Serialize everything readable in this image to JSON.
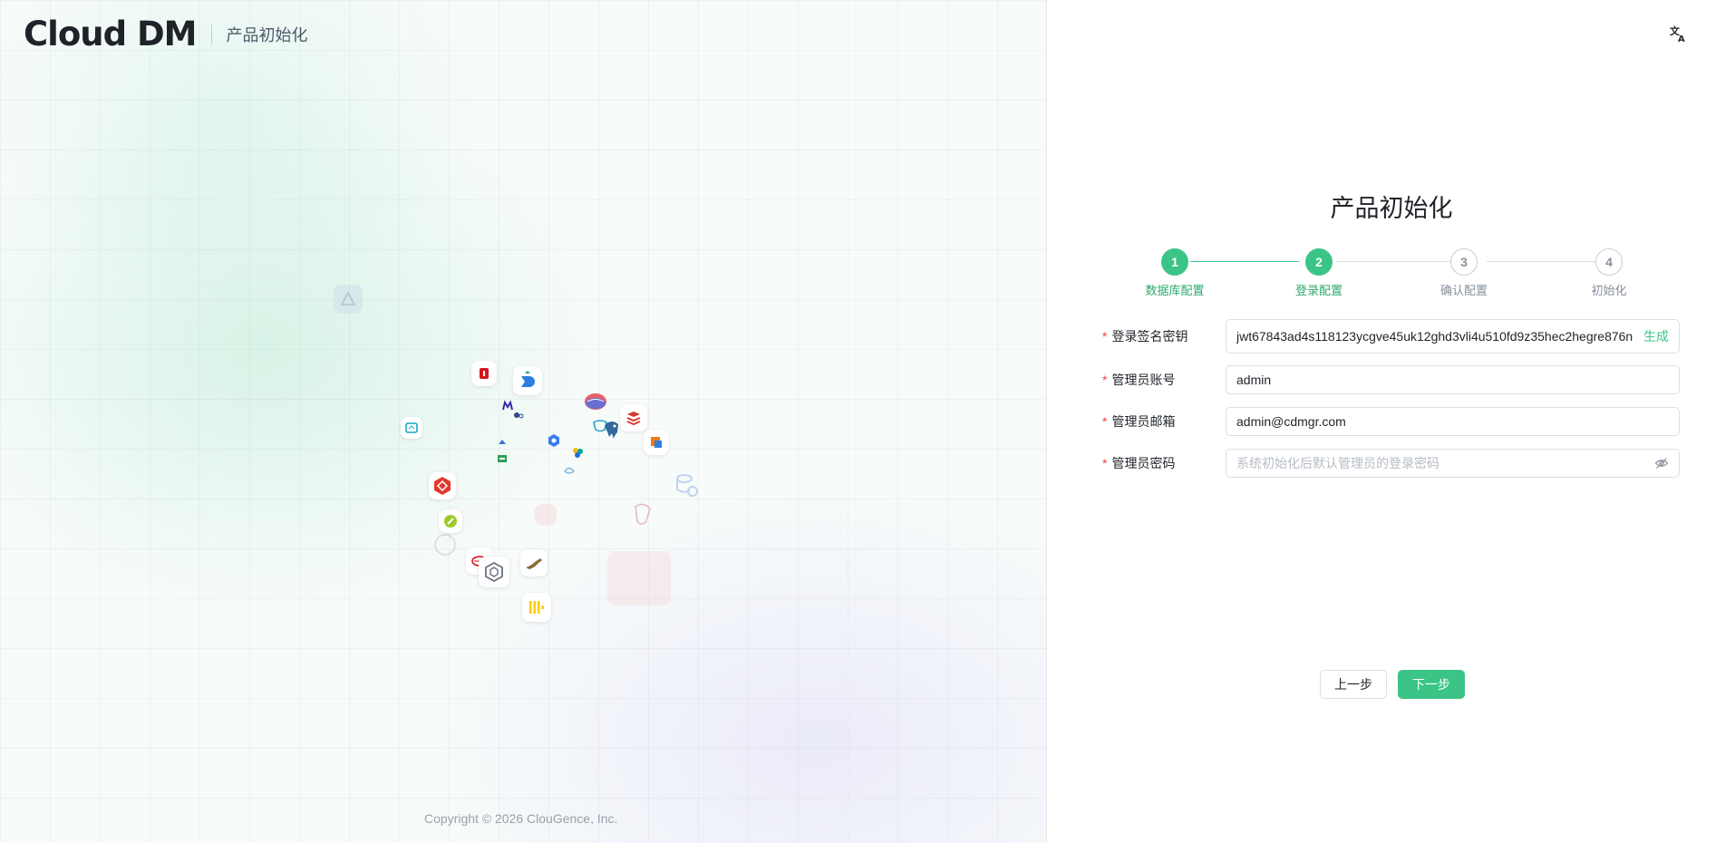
{
  "header": {
    "logo_text": "Cloud DM",
    "subtitle": "产品初始化"
  },
  "footer": {
    "copyright": "Copyright © 2026 ClouGence, Inc."
  },
  "page": {
    "title": "产品初始化"
  },
  "steps": [
    {
      "number": "1",
      "label": "数据库配置",
      "state": "done"
    },
    {
      "number": "2",
      "label": "登录配置",
      "state": "active"
    },
    {
      "number": "3",
      "label": "确认配置",
      "state": "todo"
    },
    {
      "number": "4",
      "label": "初始化",
      "state": "todo"
    }
  ],
  "form": {
    "required_mark": "*",
    "jwt": {
      "label": "登录签名密钥",
      "value": "jwt67843ad4s118123ycgve45uk12ghd3vli4u510fd9z35hec2hegre876n",
      "action": "生成"
    },
    "account": {
      "label": "管理员账号",
      "value": "admin"
    },
    "email": {
      "label": "管理员邮箱",
      "value": "admin@cdmgr.com"
    },
    "password": {
      "label": "管理员密码",
      "placeholder": "系统初始化后默认管理员的登录密码"
    }
  },
  "buttons": {
    "prev": "上一步",
    "next": "下一步"
  },
  "icons": {
    "language": "translate-icon",
    "password_toggle": "eye-slash-icon"
  },
  "colors": {
    "accent": "#3ac586",
    "required": "#f53f3f"
  }
}
